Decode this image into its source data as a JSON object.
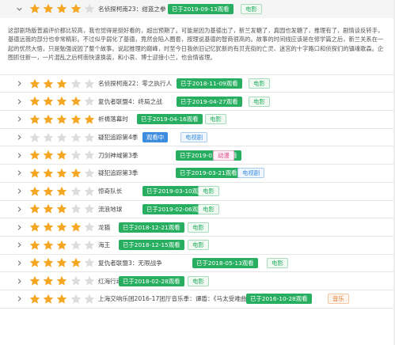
{
  "colors": {
    "star_filled": "#f5a623",
    "star_empty": "#dcdcdc",
    "date_tag": "#27ae60",
    "watching_tag": "#3c8dde",
    "movie_tag": "#27ae60",
    "tv_tag": "#3c8dde",
    "anime_tag": "#e04a8c",
    "music_tag": "#e07a2a"
  },
  "icons": {
    "expand": "chevron-down-icon",
    "collapsed": "chevron-right-icon",
    "star": "star-icon"
  },
  "items": [
    {
      "title": "名侦探柯南23：绀蓝之拳",
      "rating": 4,
      "status": "已于2019-09-13观看",
      "type": "电影",
      "type_kind": "movie",
      "expanded": true,
      "review": "这部剧场版普遍评价都比较高，我也觉得是挺好看的，超出预期了。可能是因为基德出了，新兰发糖了，真园也发糖了，推理有了，剧情谈反转手，基德远我的部分也非常精彩。不过似乎弱化了基德，竟然会陷入圈套，按理说基德的智商很高的。故事的时间线应该是在修学篇之后，新兰关系在一起的忧然大悟，只是勉强说因了整个故事。说起推理的巅峰，时至今日我依旧记忆犹新的有贝克街的亡灵、迷宫的十字路口和侦探们的镇魂歌森。企图抓住新一，一片混乱之后柯南快速换装，和小哀、博士迎接小兰，也会情省理。"
    },
    {
      "title": "名侦探柯南22：零之执行人",
      "rating": 3,
      "status": "已于2018-11-09观看",
      "type": "电影",
      "type_kind": "movie"
    },
    {
      "title": "复仇者联盟4：终局之战",
      "rating": 4,
      "status": "已于2019-04-27观看",
      "type": "电影",
      "type_kind": "movie"
    },
    {
      "title": "祈祷落幕时",
      "rating": 5,
      "status": "已于2019-04-16观看",
      "type": "电影",
      "type_kind": "movie"
    },
    {
      "title": "疑犯追踪第4季",
      "rating": 0,
      "status": "观看中",
      "status_kind": "watching",
      "type": "电视剧",
      "type_kind": "tv"
    },
    {
      "title": "刀剑神域第3季",
      "rating": 3,
      "status": "已于2019-03-31观看",
      "type": "动漫",
      "type_kind": "anime"
    },
    {
      "title": "疑犯追踪第3季",
      "rating": 4,
      "status": "已于2019-03-21观看",
      "type": "电视剧",
      "type_kind": "tv"
    },
    {
      "title": "惊奇队长",
      "rating": 3,
      "status": "已于2019-03-10观看",
      "type": "电影",
      "type_kind": "movie"
    },
    {
      "title": "流浪地球",
      "rating": 3,
      "status": "已于2019-02-06观看",
      "type": "电影",
      "type_kind": "movie"
    },
    {
      "title": "龙猫",
      "rating": 4,
      "status": "已于2018-12-21观看",
      "type": "电影",
      "type_kind": "movie"
    },
    {
      "title": "海王",
      "rating": 3,
      "status": "已于2018-12-15观看",
      "type": "电影",
      "type_kind": "movie"
    },
    {
      "title": "复仇者联盟3：无限战争",
      "rating": 4,
      "status": "已于2018-05-13观看",
      "type": "电影",
      "type_kind": "movie"
    },
    {
      "title": "红海行动",
      "rating": 3,
      "status": "已于2018-02-28观看",
      "type": "电影",
      "type_kind": "movie"
    },
    {
      "title": "上海交响乐团2016-17团厅音乐季：谭盾：《马太受难曲》",
      "rating": 3,
      "status": "已于2016-10-28观看",
      "type": "音乐",
      "type_kind": "music"
    }
  ]
}
